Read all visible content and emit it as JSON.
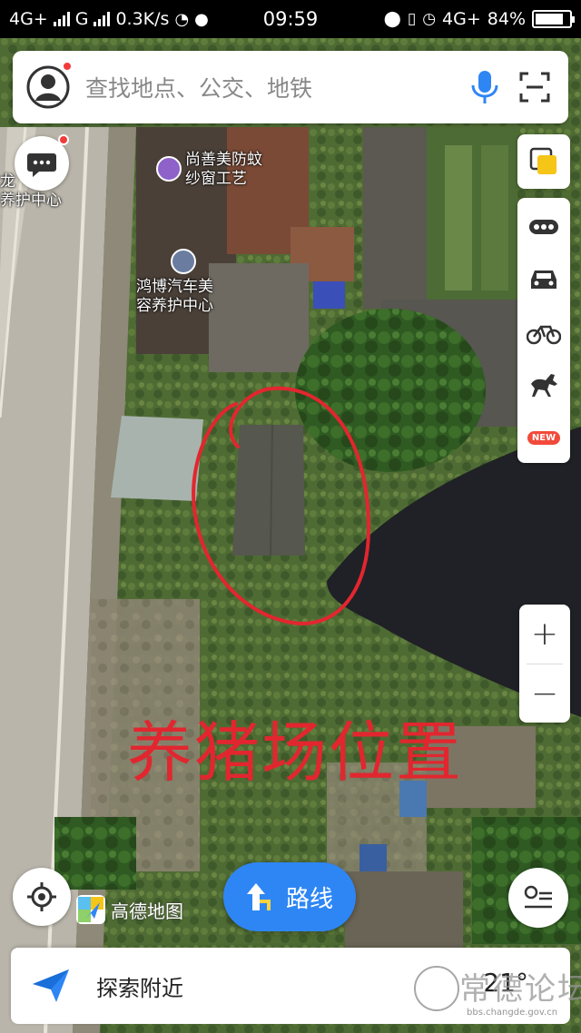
{
  "status_bar": {
    "network1": "4G+",
    "network2": "G",
    "speed": "0.3K/s",
    "time": "09:59",
    "network3": "4G+",
    "battery_percent": "84%",
    "battery_level": 0.84
  },
  "search": {
    "placeholder": "查找地点、公交、地铁"
  },
  "map": {
    "pois": [
      {
        "name_line1": "龙",
        "name_line2": "养护中心"
      },
      {
        "name_line1": "尚善美防蚊",
        "name_line2": "纱窗工艺"
      },
      {
        "name_line1": "鸿博汽车美",
        "name_line2": "容养护中心"
      }
    ],
    "annotation": "养猪场位置",
    "annotation_color": "#e2262f",
    "brand": "高德地图"
  },
  "tools": {
    "new_badge": "NEW"
  },
  "zoom": {
    "in_label": "+",
    "out_label": "−"
  },
  "route": {
    "label": "路线"
  },
  "bottom": {
    "explore_label": "探索附近",
    "temperature": "21°"
  },
  "watermark": {
    "text": "常德论坛",
    "url": "bbs.changde.gov.cn"
  },
  "colors": {
    "accent": "#2e86f5",
    "badge_red": "#f23b3b"
  }
}
